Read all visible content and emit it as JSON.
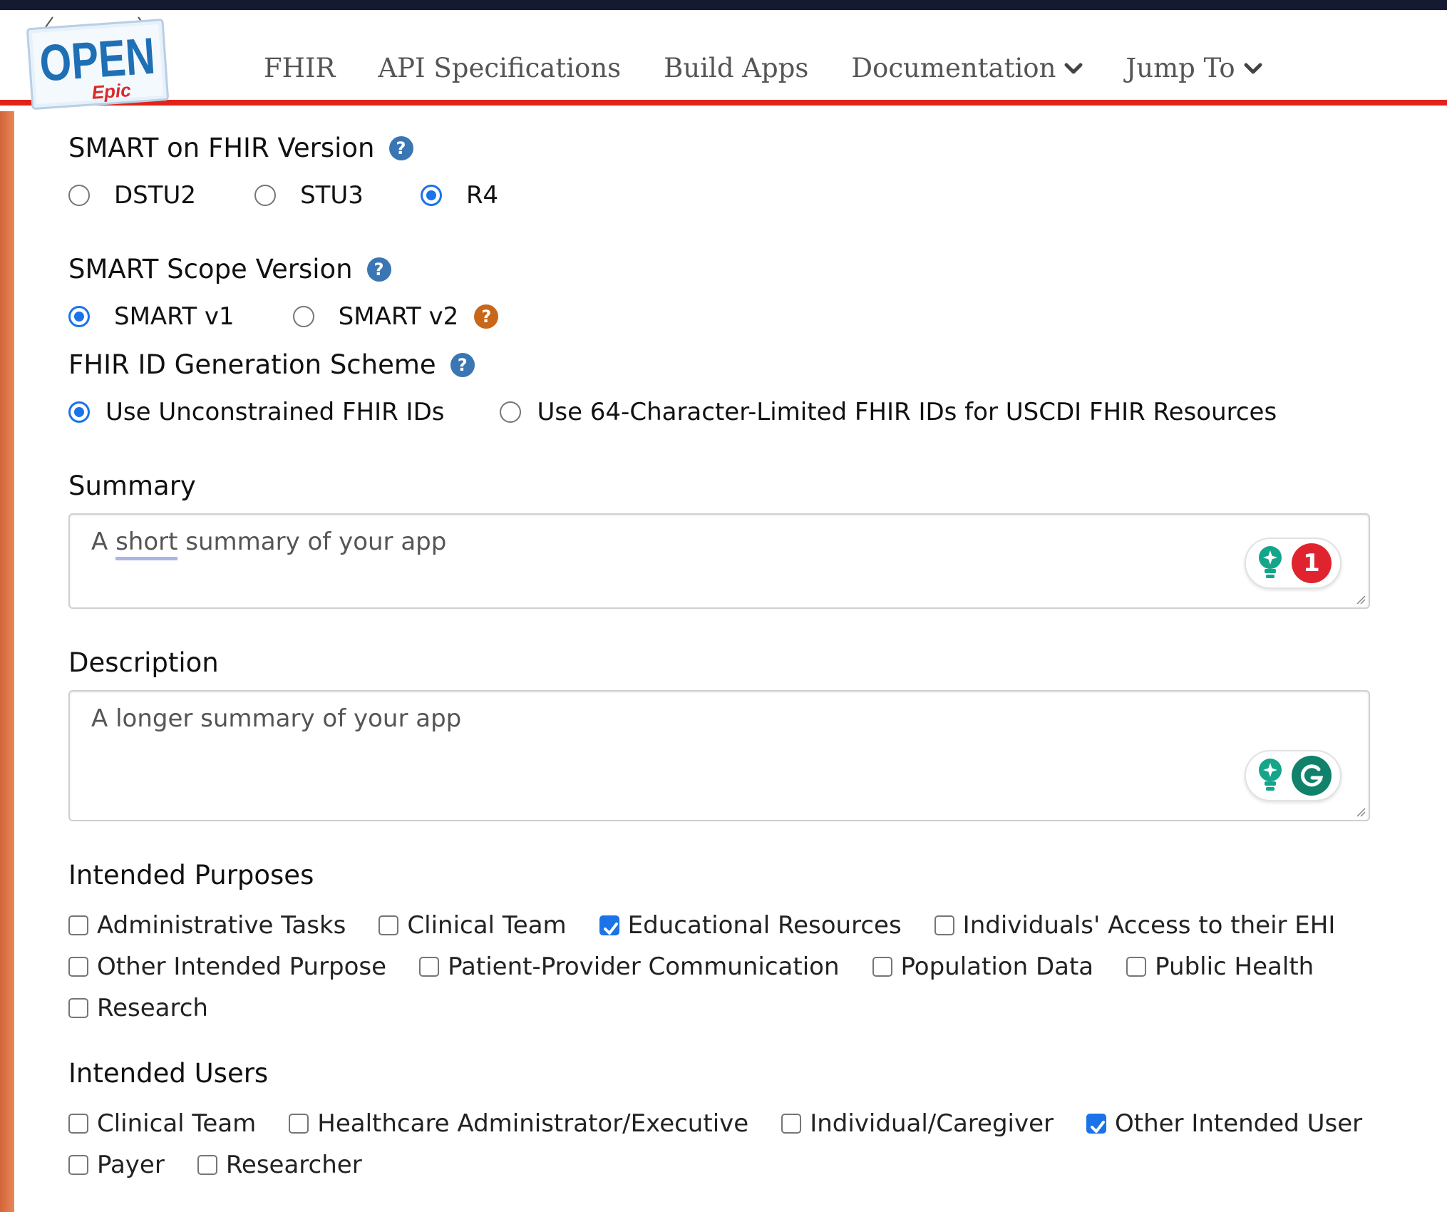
{
  "header": {
    "logo_text": "OPEN",
    "logo_sub": "Epic",
    "nav": [
      {
        "label": "FHIR",
        "dropdown": false
      },
      {
        "label": "API Specifications",
        "dropdown": false
      },
      {
        "label": "Build Apps",
        "dropdown": false
      },
      {
        "label": "Documentation",
        "dropdown": true
      },
      {
        "label": "Jump To",
        "dropdown": true
      }
    ]
  },
  "fhir_version": {
    "label": "SMART on FHIR Version",
    "options": [
      {
        "label": "DSTU2",
        "selected": false
      },
      {
        "label": "STU3",
        "selected": false
      },
      {
        "label": "R4",
        "selected": true
      }
    ]
  },
  "scope_version": {
    "label": "SMART Scope Version",
    "options": [
      {
        "label": "SMART v1",
        "selected": true
      },
      {
        "label": "SMART v2",
        "selected": false
      }
    ]
  },
  "id_scheme": {
    "label": "FHIR ID Generation Scheme",
    "options": [
      {
        "label": "Use Unconstrained FHIR IDs",
        "selected": true
      },
      {
        "label": "Use 64-Character-Limited FHIR IDs for USCDI FHIR Resources",
        "selected": false
      }
    ]
  },
  "summary": {
    "label": "Summary",
    "placeholder_pre": "A ",
    "placeholder_flagged": "short",
    "placeholder_post": " summary of your app",
    "issue_count": "1"
  },
  "description": {
    "label": "Description",
    "placeholder": "A longer summary of your app"
  },
  "intended_purposes": {
    "label": "Intended Purposes",
    "options": [
      {
        "label": "Administrative Tasks",
        "checked": false
      },
      {
        "label": "Clinical Team",
        "checked": false
      },
      {
        "label": "Educational Resources",
        "checked": true
      },
      {
        "label": "Individuals' Access to their EHI",
        "checked": false
      },
      {
        "label": "Other Intended Purpose",
        "checked": false
      },
      {
        "label": "Patient-Provider Communication",
        "checked": false
      },
      {
        "label": "Population Data",
        "checked": false
      },
      {
        "label": "Public Health",
        "checked": false
      },
      {
        "label": "Research",
        "checked": false
      }
    ]
  },
  "intended_users": {
    "label": "Intended Users",
    "options": [
      {
        "label": "Clinical Team",
        "checked": false
      },
      {
        "label": "Healthcare Administrator/Executive",
        "checked": false
      },
      {
        "label": "Individual/Caregiver",
        "checked": false
      },
      {
        "label": "Other Intended User",
        "checked": true
      },
      {
        "label": "Payer",
        "checked": false
      },
      {
        "label": "Researcher",
        "checked": false
      }
    ]
  },
  "colors": {
    "accent_blue": "#1a73e8",
    "nav_red": "#e3231a",
    "help_blue": "#3a76b3",
    "help_orange": "#c8671a",
    "grammarly_green": "#10826b",
    "badge_red": "#e0242f"
  }
}
